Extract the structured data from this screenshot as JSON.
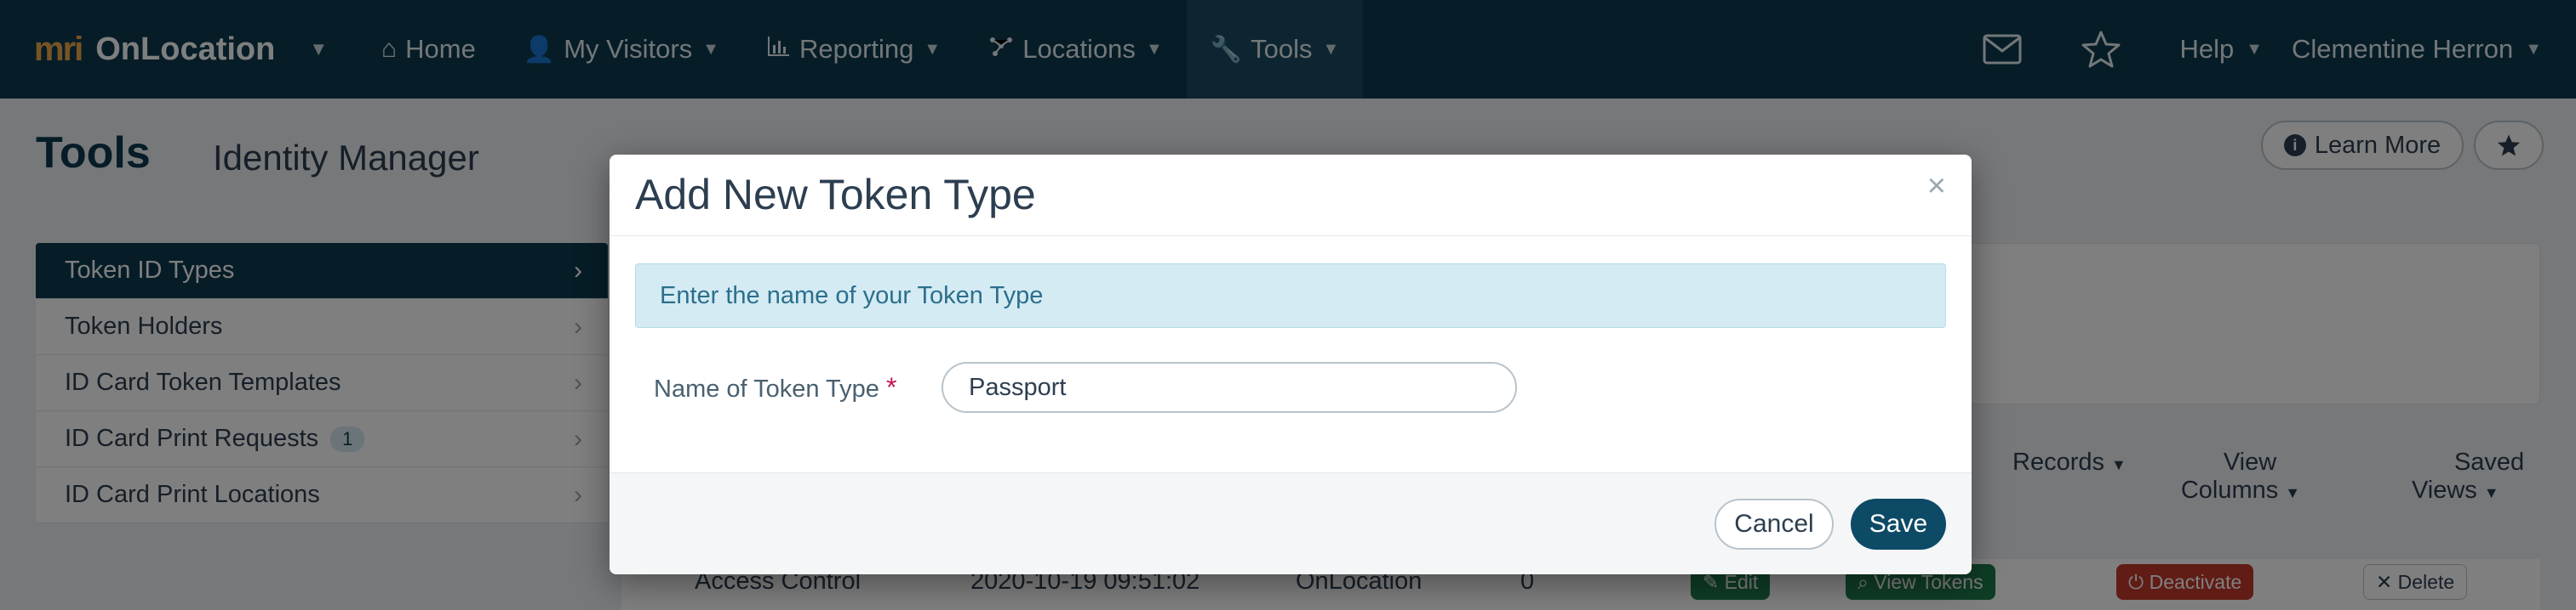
{
  "navbar": {
    "brand_logo": "mri",
    "brand_name": "OnLocation",
    "items": [
      {
        "label": "Home",
        "icon": "home-icon"
      },
      {
        "label": "My Visitors",
        "icon": "user-icon"
      },
      {
        "label": "Reporting",
        "icon": "bar-chart-icon"
      },
      {
        "label": "Locations",
        "icon": "network-icon"
      },
      {
        "label": "Tools",
        "icon": "wrench-icon"
      }
    ],
    "help_label": "Help",
    "user_name": "Clementine Herron"
  },
  "page": {
    "title": "Tools",
    "subtitle": "Identity Manager",
    "learn_more_label": "Learn More"
  },
  "sidebar": {
    "items": [
      {
        "label": "Token ID Types",
        "active": true
      },
      {
        "label": "Token Holders"
      },
      {
        "label": "ID Card Token Templates"
      },
      {
        "label": "ID Card Print Requests",
        "badge": "1"
      },
      {
        "label": "ID Card Print Locations"
      }
    ]
  },
  "toolbar": {
    "records_label": "Records",
    "view_columns_label": "View Columns",
    "saved_views_label": "Saved Views"
  },
  "table_row": {
    "name": "Access Control",
    "date": "2020-10-19 09:51:02",
    "source": "OnLocation",
    "count": "0",
    "edit_label": "Edit",
    "view_tokens_label": "View Tokens",
    "deactivate_label": "Deactivate",
    "delete_label": "Delete"
  },
  "modal": {
    "title": "Add New Token Type",
    "close_label": "×",
    "info_text": "Enter the name of your Token Type",
    "field_label": "Name of Token Type",
    "required_mark": "*",
    "field_value": "Passport",
    "cancel_label": "Cancel",
    "save_label": "Save"
  },
  "colors": {
    "navbar_bg": "#0d3a4f",
    "primary": "#0d4a66",
    "info_bg": "#d4ebf4",
    "required": "#c2185b"
  }
}
